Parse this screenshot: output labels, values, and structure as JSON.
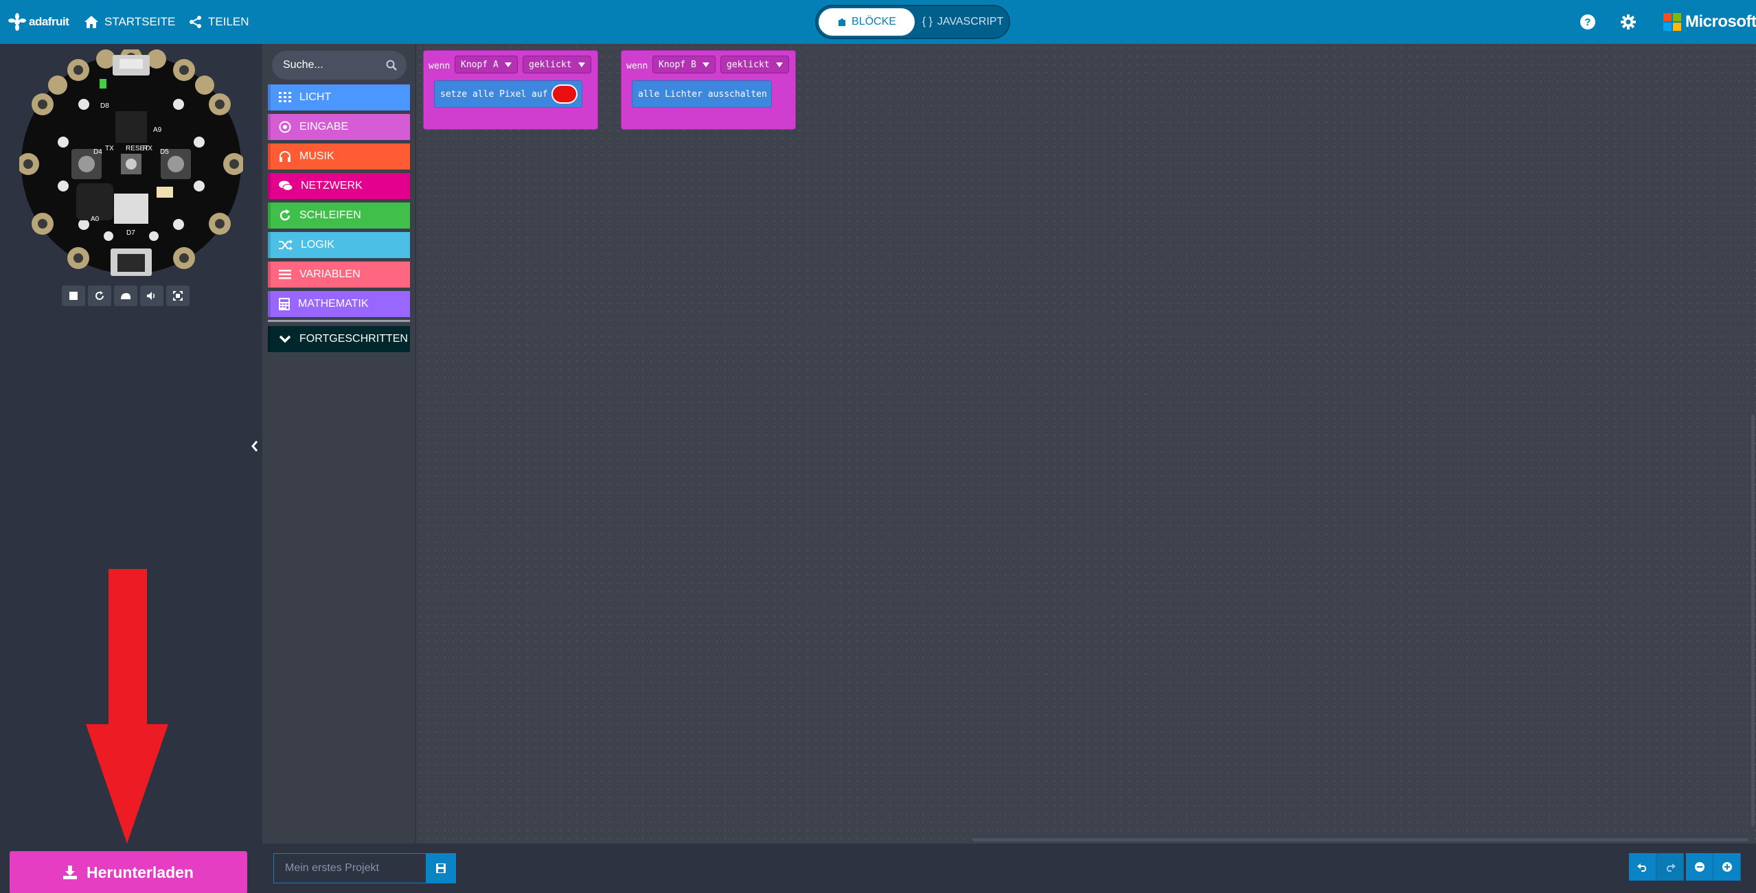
{
  "header": {
    "logo_text": "adafruit",
    "home_label": "STARTSEITE",
    "share_label": "TEILEN",
    "tabs": [
      {
        "label": "BLÖCKE",
        "active": true
      },
      {
        "label": "JAVASCRIPT",
        "active": false
      }
    ],
    "brand_text": "Microsoft"
  },
  "toolbox": {
    "search_placeholder": "Suche...",
    "categories": [
      {
        "label": "LICHT",
        "color": "#4c97ff",
        "icon": "grid-icon"
      },
      {
        "label": "EINGABE",
        "color": "#d65cd6",
        "icon": "target-icon"
      },
      {
        "label": "MUSIK",
        "color": "#ff5c33",
        "icon": "headphones-icon"
      },
      {
        "label": "NETZWERK",
        "color": "#e3008c",
        "icon": "chat-icon"
      },
      {
        "label": "SCHLEIFEN",
        "color": "#40bf4a",
        "icon": "refresh-icon"
      },
      {
        "label": "LOGIK",
        "color": "#4cbfe6",
        "icon": "shuffle-icon"
      },
      {
        "label": "VARIABLEN",
        "color": "#ff6680",
        "icon": "list-icon"
      },
      {
        "label": "MATHEMATIK",
        "color": "#9966ff",
        "icon": "calculator-icon"
      },
      {
        "label": "FORTGESCHRITTEN",
        "color": "#00272b",
        "icon": "chevron-down-icon"
      }
    ]
  },
  "workspace": {
    "blocks": [
      {
        "keyword": "wenn",
        "button": "Knopf A",
        "event": "geklickt",
        "statement": "setze alle Pixel auf",
        "color_value": "#e90f0f"
      },
      {
        "keyword": "wenn",
        "button": "Knopf B",
        "event": "geklickt",
        "statement": "alle Lichter ausschalten"
      }
    ]
  },
  "simulator": {
    "controls": [
      "stop-icon",
      "restart-icon",
      "slowmo-icon",
      "sound-icon",
      "fullscreen-icon"
    ]
  },
  "footer": {
    "download_label": "Herunterladen",
    "project_placeholder": "Mein erstes Projekt"
  },
  "colors": {
    "header_bg": "#0480b6",
    "download": "#e63ec2",
    "arrow": "#ed1c24",
    "event_block": "#d03ecf",
    "light_block": "#3e87de"
  }
}
